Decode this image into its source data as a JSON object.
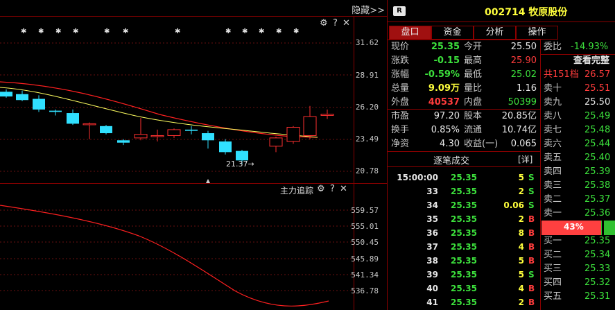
{
  "toolbar": {
    "hide_label": "隐藏>>"
  },
  "price_axis": [
    "31.62",
    "28.91",
    "26.20",
    "23.49",
    "20.78"
  ],
  "min_price_label": "21.37→",
  "indicator": {
    "title": "主力追踪"
  },
  "indicator_axis": [
    "559.57",
    "555.01",
    "550.45",
    "545.89",
    "541.34",
    "536.78"
  ],
  "chart_data": {
    "type": "candlestick",
    "candles": [
      {
        "open": 27.5,
        "close": 27.1,
        "high": 27.7,
        "low": 27.0
      },
      {
        "open": 27.3,
        "close": 26.8,
        "high": 27.6,
        "low": 26.7
      },
      {
        "open": 26.9,
        "close": 26.0,
        "high": 27.2,
        "low": 25.8
      },
      {
        "open": 25.9,
        "close": 25.8,
        "high": 26.0,
        "low": 25.5
      },
      {
        "open": 25.7,
        "close": 24.8,
        "high": 26.0,
        "low": 24.7
      },
      {
        "open": 24.8,
        "close": 24.8,
        "high": 24.9,
        "low": 23.5
      },
      {
        "open": 24.6,
        "close": 24.0,
        "high": 24.7,
        "low": 23.9
      },
      {
        "open": 23.4,
        "close": 23.2,
        "high": 23.5,
        "low": 23.0
      },
      {
        "open": 23.6,
        "close": 23.9,
        "high": 25.3,
        "low": 23.4
      },
      {
        "open": 23.8,
        "close": 23.8,
        "high": 24.3,
        "low": 23.3
      },
      {
        "open": 23.8,
        "close": 24.3,
        "high": 24.4,
        "low": 23.6
      },
      {
        "open": 24.3,
        "close": 24.2,
        "high": 24.6,
        "low": 23.9
      },
      {
        "open": 24.0,
        "close": 23.4,
        "high": 24.2,
        "low": 22.7
      },
      {
        "open": 23.3,
        "close": 22.4,
        "high": 23.5,
        "low": 22.2
      },
      {
        "open": 22.5,
        "close": 21.7,
        "high": 22.6,
        "low": 21.37
      },
      {
        "open": 22.9,
        "close": 23.6,
        "high": 23.7,
        "low": 22.4
      },
      {
        "open": 23.3,
        "close": 24.5,
        "high": 24.6,
        "low": 23.1
      },
      {
        "open": 23.8,
        "close": 25.4,
        "high": 26.3,
        "low": 23.5
      },
      {
        "open": 25.5,
        "close": 25.6,
        "high": 26.0,
        "low": 25.2
      }
    ],
    "ylim": [
      20.78,
      31.62
    ],
    "indicator_ylim": [
      536.78,
      559.57
    ]
  },
  "quote": {
    "badge": "R",
    "code": "002714",
    "name": "牧原股份",
    "tabs": [
      "盘口",
      "资金",
      "分析",
      "操作"
    ],
    "left_rows": [
      {
        "l1": "现价",
        "v1": "25.35",
        "c1": "green",
        "l2": "今开",
        "v2": "25.50",
        "c2": "white"
      },
      {
        "l1": "涨跌",
        "v1": "-0.15",
        "c1": "green",
        "l2": "最高",
        "v2": "25.90",
        "c2": "red"
      },
      {
        "l1": "涨幅",
        "v1": "-0.59%",
        "c1": "green",
        "l2": "最低",
        "v2": "25.02",
        "c2": "green"
      },
      {
        "l1": "总量",
        "v1": "9.09万",
        "c1": "yellow",
        "l2": "量比",
        "v2": "1.16",
        "c2": "white"
      },
      {
        "l1": "外盘",
        "v1": "40537",
        "c1": "red",
        "l2": "内盘",
        "v2": "50399",
        "c2": "green"
      }
    ],
    "left_rows2": [
      {
        "l1": "市盈",
        "v1": "97.20",
        "l2": "股本",
        "v2": "20.85亿"
      },
      {
        "l1": "换手",
        "v1": "0.85%",
        "l2": "流通",
        "v2": "10.74亿"
      },
      {
        "l1": "净资",
        "v1": "4.30",
        "l2": "收益(一)",
        "v2": "0.065"
      }
    ],
    "trades_title": "逐笔成交",
    "trades_detail": "[详]",
    "trades": [
      {
        "t": "15:00:00",
        "p": "25.35",
        "v": "5",
        "s": "S"
      },
      {
        "t": "33",
        "p": "25.35",
        "v": "2",
        "s": "S"
      },
      {
        "t": "34",
        "p": "25.35",
        "v": "0.06",
        "s": "S"
      },
      {
        "t": "35",
        "p": "25.35",
        "v": "2",
        "s": "B"
      },
      {
        "t": "36",
        "p": "25.35",
        "v": "8",
        "s": "B"
      },
      {
        "t": "37",
        "p": "25.35",
        "v": "4",
        "s": "B"
      },
      {
        "t": "38",
        "p": "25.35",
        "v": "5",
        "s": "B"
      },
      {
        "t": "39",
        "p": "25.35",
        "v": "5",
        "s": "S"
      },
      {
        "t": "40",
        "p": "25.35",
        "v": "4",
        "s": "B"
      },
      {
        "t": "41",
        "p": "25.35",
        "v": "2",
        "s": "B"
      }
    ],
    "weibi_label": "委比",
    "weibi_value": "-14.93%",
    "view_full": "查看完整",
    "total_levels": "共151档",
    "total_levels_price": "26.57",
    "asks": [
      {
        "l": "卖十",
        "p": "25.51",
        "c": "red"
      },
      {
        "l": "卖九",
        "p": "25.50",
        "c": "white"
      },
      {
        "l": "卖八",
        "p": "25.49",
        "c": "green"
      },
      {
        "l": "卖七",
        "p": "25.48",
        "c": "green"
      },
      {
        "l": "卖六",
        "p": "25.44",
        "c": "green"
      },
      {
        "l": "卖五",
        "p": "25.40",
        "c": "green"
      },
      {
        "l": "卖四",
        "p": "25.39",
        "c": "green"
      },
      {
        "l": "卖三",
        "p": "25.38",
        "c": "green"
      },
      {
        "l": "卖二",
        "p": "25.37",
        "c": "green"
      },
      {
        "l": "卖一",
        "p": "25.36",
        "c": "green"
      }
    ],
    "ratio_label": "43%",
    "ratio_value": 0.43,
    "bids": [
      {
        "l": "买一",
        "p": "25.35"
      },
      {
        "l": "买二",
        "p": "25.34"
      },
      {
        "l": "买三",
        "p": "25.33"
      },
      {
        "l": "买四",
        "p": "25.32"
      },
      {
        "l": "买五",
        "p": "25.31"
      }
    ]
  }
}
